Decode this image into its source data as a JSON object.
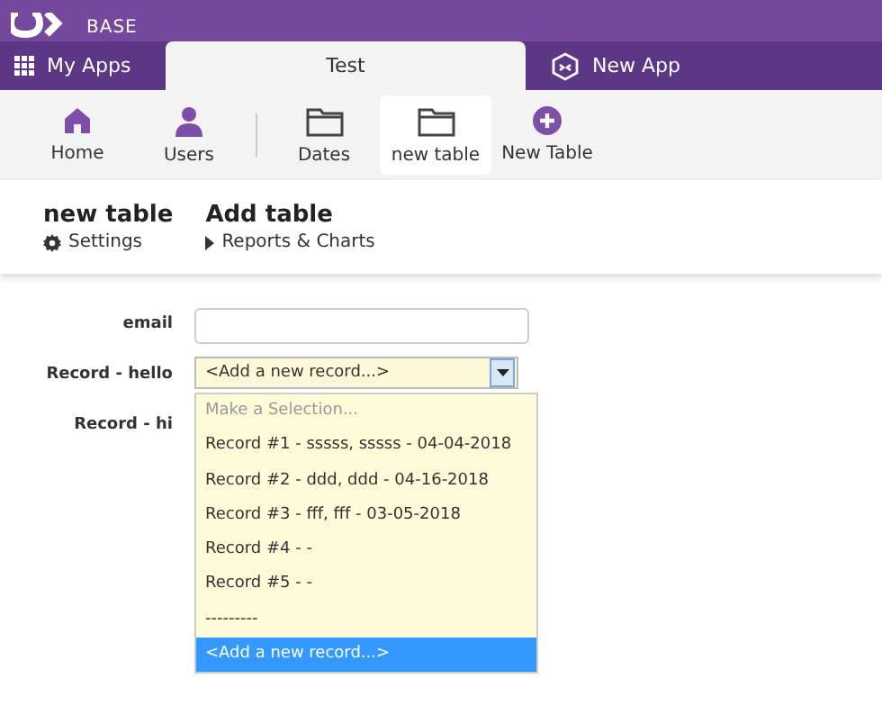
{
  "logo": {
    "text": "BASE"
  },
  "app_tabs": [
    {
      "label": "My Apps",
      "kind": "apps",
      "selected": false
    },
    {
      "label": "Test",
      "kind": "plain",
      "selected": true
    },
    {
      "label": "New App",
      "kind": "new",
      "selected": false
    }
  ],
  "toolbar": [
    {
      "label": "Home",
      "kind": "home",
      "selected": false
    },
    {
      "label": "Users",
      "kind": "user",
      "selected": false
    },
    {
      "label": "Dates",
      "kind": "folder",
      "selected": false
    },
    {
      "label": "new table",
      "kind": "folder",
      "selected": true
    },
    {
      "label": "New Table",
      "kind": "add",
      "selected": false
    }
  ],
  "header": {
    "title": "new table",
    "settings": "Settings",
    "action": "Add table",
    "reports": "Reports & Charts"
  },
  "form": {
    "fields": [
      {
        "label": "email",
        "kind": "text"
      },
      {
        "label": "Record - hello",
        "kind": "select",
        "value": "<Add a new record...>"
      },
      {
        "label": "Record - hi",
        "kind": "blank"
      }
    ]
  },
  "dropdown": {
    "prompt": "Make a Selection...",
    "options": [
      {
        "label": "Record #1 - sssss, sssss - 04-04-2018",
        "selected": false
      },
      {
        "label": "Record #2 - ddd, ddd - 04-16-2018",
        "selected": false
      },
      {
        "label": "Record #3 - fff, fff - 03-05-2018",
        "selected": false
      },
      {
        "label": "Record #4 -  -",
        "selected": false
      },
      {
        "label": "Record #5 -  -",
        "selected": false
      },
      {
        "label": "---------",
        "selected": false
      },
      {
        "label": "<Add a new record...>",
        "selected": true
      }
    ]
  }
}
